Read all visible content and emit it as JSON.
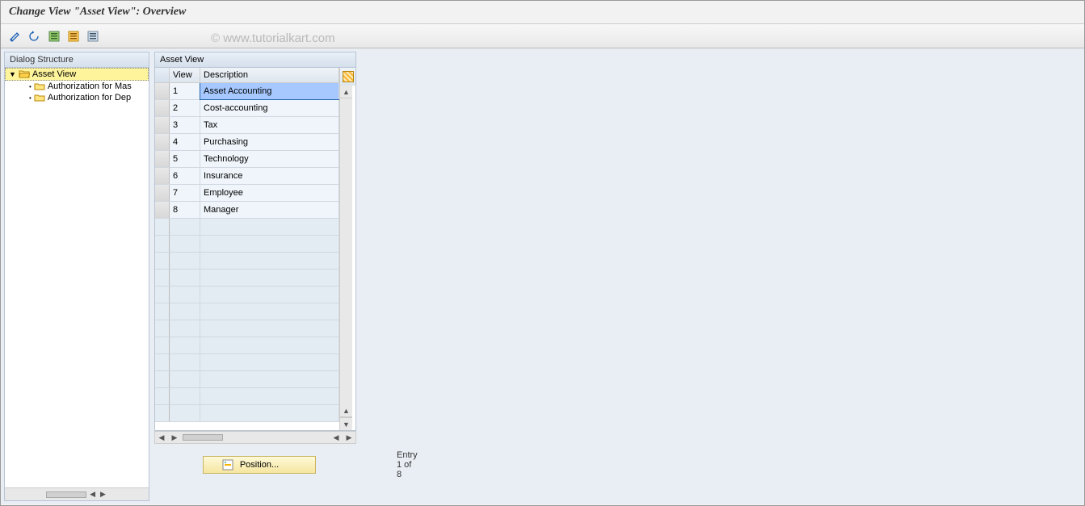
{
  "title": "Change View \"Asset View\": Overview",
  "watermark": "© www.tutorialkart.com",
  "tree": {
    "header": "Dialog Structure",
    "root": "Asset View",
    "children": [
      "Authorization for Mas",
      "Authorization for Dep"
    ]
  },
  "table": {
    "title": "Asset View",
    "columns": {
      "view": "View",
      "desc": "Description"
    },
    "rows": [
      {
        "view": "1",
        "desc": "Asset Accounting"
      },
      {
        "view": "2",
        "desc": "Cost-accounting"
      },
      {
        "view": "3",
        "desc": "Tax"
      },
      {
        "view": "4",
        "desc": "Purchasing"
      },
      {
        "view": "5",
        "desc": "Technology"
      },
      {
        "view": "6",
        "desc": "Insurance"
      },
      {
        "view": "7",
        "desc": "Employee"
      },
      {
        "view": "8",
        "desc": "Manager"
      }
    ],
    "empty_rows": 12
  },
  "footer": {
    "position_label": "Position...",
    "entry_info": "Entry 1 of 8"
  }
}
